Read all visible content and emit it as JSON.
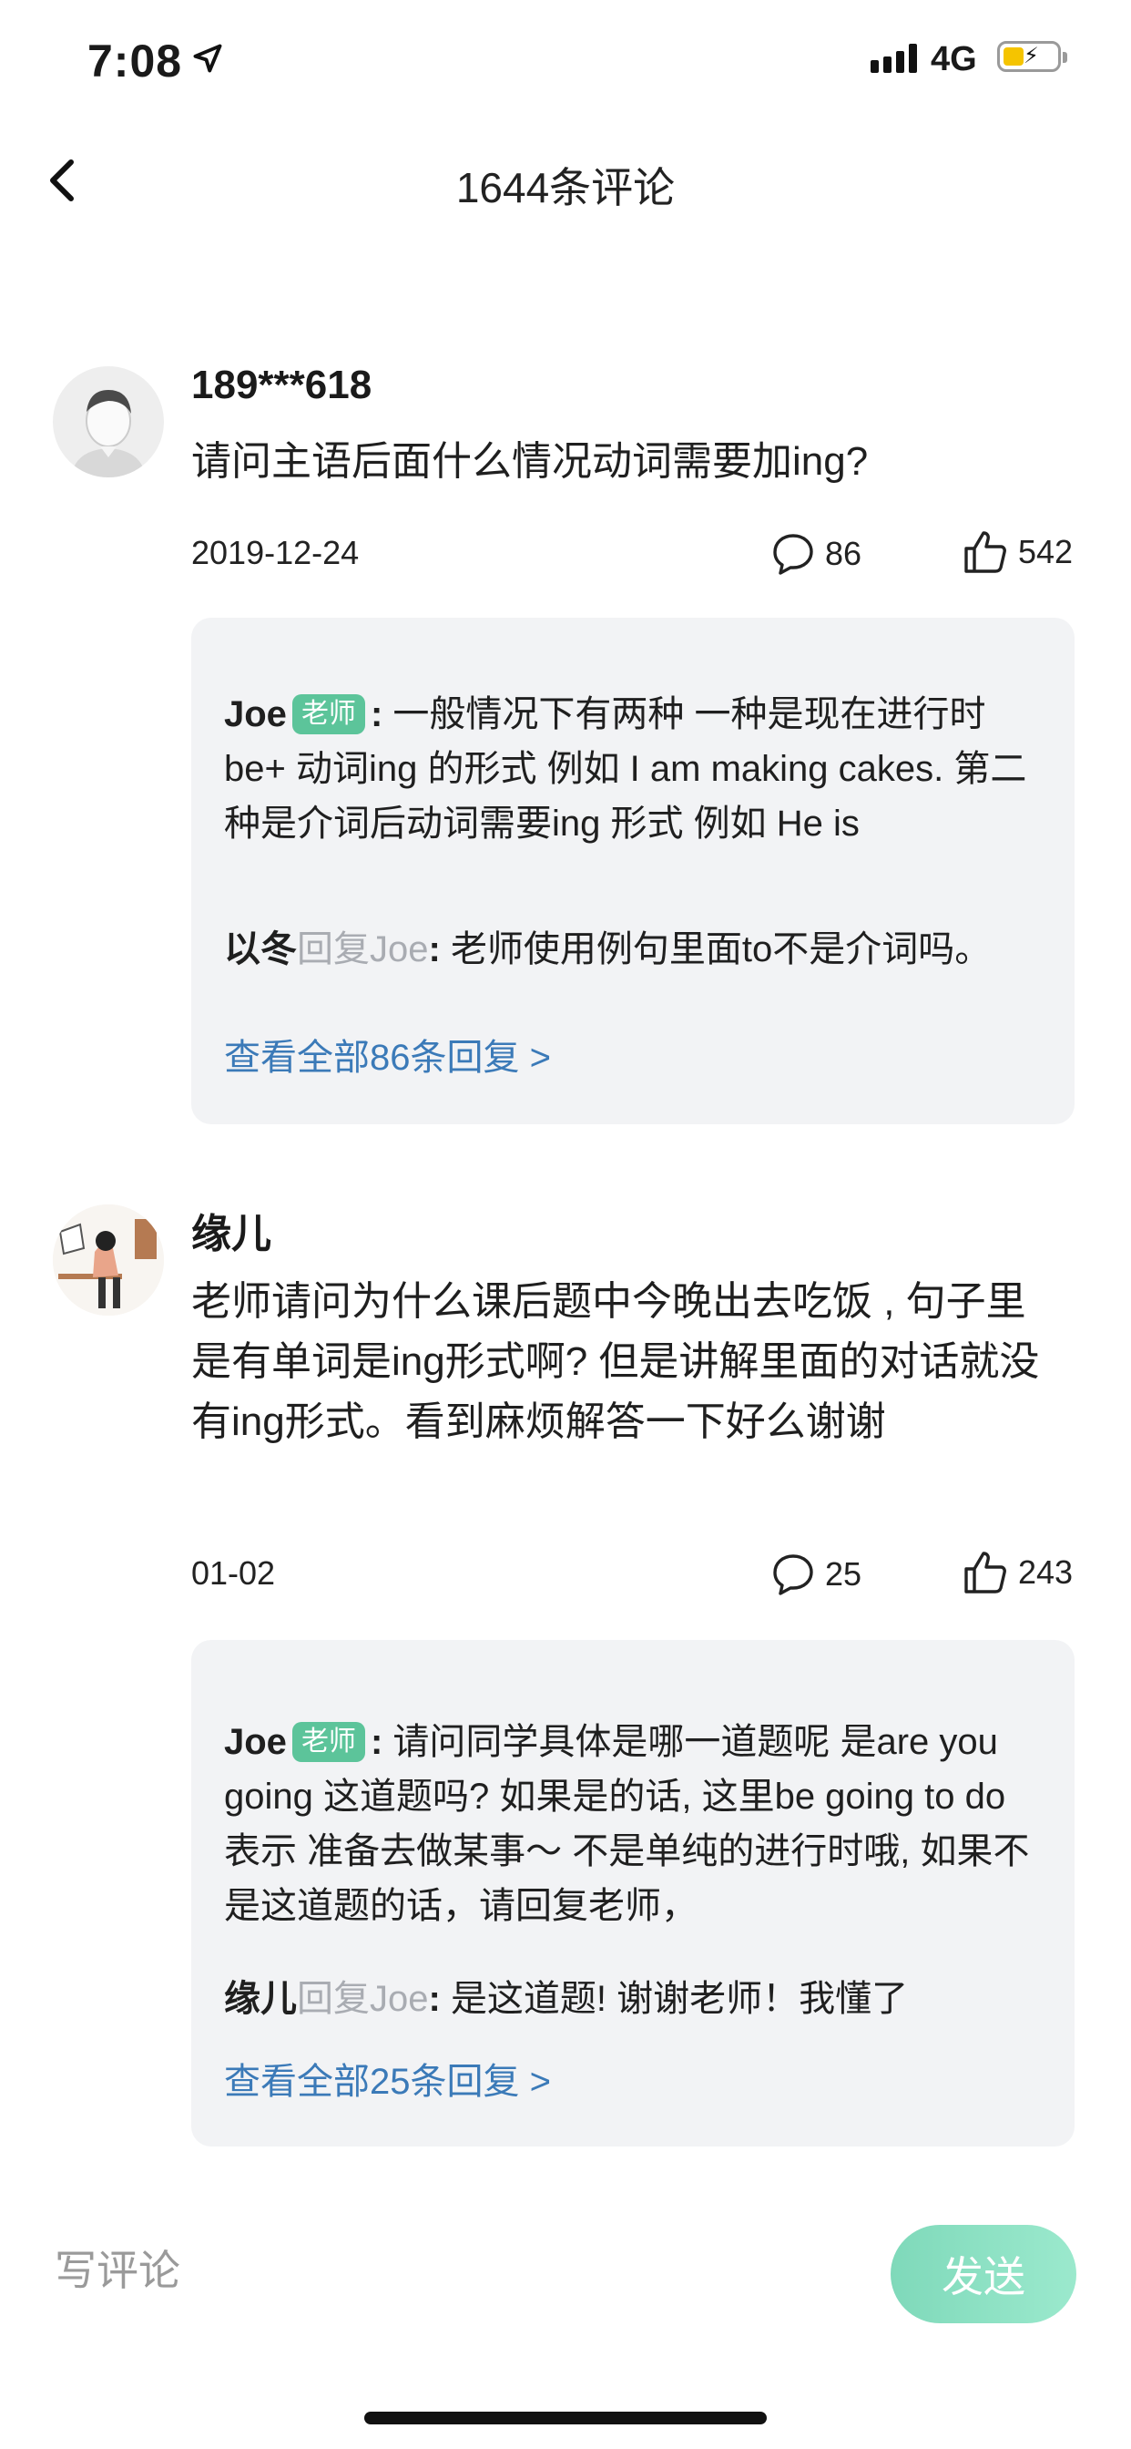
{
  "status_bar": {
    "time": "7:08",
    "network": "4G"
  },
  "nav": {
    "title": "1644条评论"
  },
  "comments": [
    {
      "user": "189***618",
      "text": "请问主语后面什么情况动词需要加ing?",
      "date": "2019-12-24",
      "reply_count": "86",
      "like_count": "542",
      "replies": [
        {
          "name": "Joe",
          "badge": "老师",
          "text": "一般情况下有两种 一种是现在进行时 be+ 动词ing 的形式 例如 I am making cakes. 第二种是介词后动词需要ing 形式 例如 He is"
        },
        {
          "name": "以冬",
          "reply_word": "回复",
          "reply_target": "Joe",
          "text": "老师使用例句里面to不是介词吗。"
        }
      ],
      "view_all": "查看全部86条回复 >"
    },
    {
      "user": "缘儿",
      "text": "老师请问为什么课后题中今晚出去吃饭 , 句子里是有单词是ing形式啊? 但是讲解里面的对话就没有ing形式。看到麻烦解答一下好么谢谢",
      "date": "01-02",
      "reply_count": "25",
      "like_count": "243",
      "replies": [
        {
          "name": "Joe",
          "badge": "老师",
          "text": "请问同学具体是哪一道题呢 是are you going 这道题吗? 如果是的话, 这里be going to do 表示 准备去做某事～ 不是单纯的进行时哦, 如果不是这道题的话，请回复老师，"
        },
        {
          "name": "缘儿",
          "reply_word": "回复",
          "reply_target": "Joe",
          "text": "是这道题! 谢谢老师！我懂了"
        }
      ],
      "view_all": "查看全部25条回复 >"
    }
  ],
  "input": {
    "placeholder": "写评论",
    "send_label": "发送"
  },
  "colors": {
    "badge": "#5cc49a",
    "link": "#3b7ab8",
    "send": "#8fe3c4",
    "reply_bg": "#f2f3f5"
  }
}
